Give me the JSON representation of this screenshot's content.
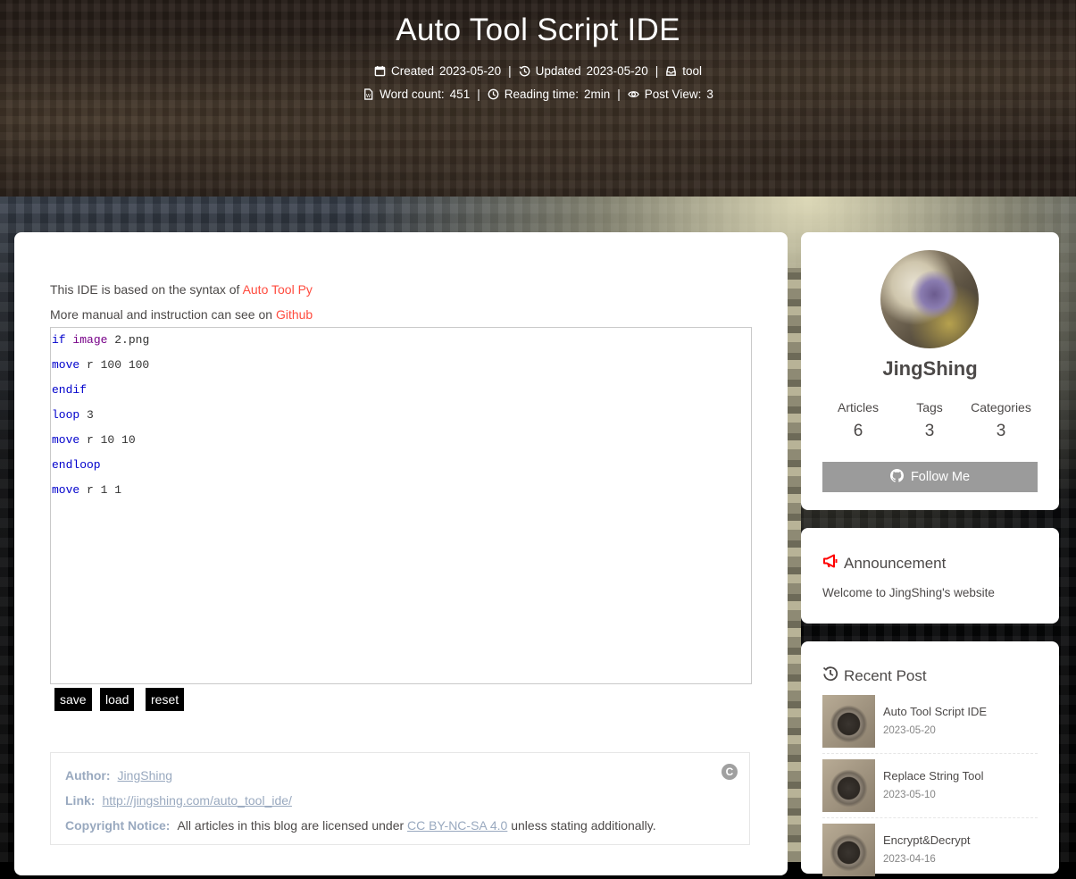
{
  "header": {
    "title": "Auto Tool Script IDE",
    "created_label": "Created",
    "created_date": "2023-05-20",
    "updated_label": "Updated",
    "updated_date": "2023-05-20",
    "category": "tool",
    "word_count_label": "Word count:",
    "word_count": "451",
    "reading_time_label": "Reading time:",
    "reading_time": "2min",
    "post_view_label": "Post View:",
    "post_view": "3",
    "separator": "|"
  },
  "intro": {
    "line1_prefix": "This IDE is based on the syntax of ",
    "line1_link": "Auto Tool Py",
    "line2_prefix": "More manual and instruction can see on ",
    "line2_link": "Github"
  },
  "editor": {
    "lines": [
      {
        "kw": "if",
        "kw2": "image",
        "rest": " 2.png"
      },
      {
        "kw": "move",
        "kw2": "",
        "rest": " r 100 100"
      },
      {
        "kw": "endif",
        "kw2": "",
        "rest": ""
      },
      {
        "kw": "loop",
        "kw2": "",
        "rest": " 3"
      },
      {
        "kw": "move",
        "kw2": "",
        "rest": " r 10 10"
      },
      {
        "kw": "endloop",
        "kw2": "",
        "rest": ""
      },
      {
        "kw": "move",
        "kw2": "",
        "rest": " r 1 1"
      }
    ]
  },
  "buttons": {
    "save": "save",
    "load": "load",
    "reset": "reset"
  },
  "copyright": {
    "author_key": "Author:",
    "author_val": "JingShing",
    "link_key": "Link:",
    "link_val": "http://jingshing.com/auto_tool_ide/",
    "notice_key": "Copyright Notice:",
    "notice_prefix": "All articles in this blog are licensed under ",
    "notice_link": "CC BY-NC-SA 4.0",
    "notice_suffix": " unless stating additionally.",
    "cc_badge": "C"
  },
  "author": {
    "name": "JingShing",
    "articles_label": "Articles",
    "articles": "6",
    "tags_label": "Tags",
    "tags": "3",
    "categories_label": "Categories",
    "categories": "3",
    "follow_label": "Follow Me"
  },
  "announcement": {
    "title": "Announcement",
    "text": "Welcome to JingShing's website",
    "icon": "megaphone-icon",
    "icon_color": "#ff0000"
  },
  "recent": {
    "title": "Recent Post",
    "posts": [
      {
        "title": "Auto Tool Script IDE",
        "date": "2023-05-20"
      },
      {
        "title": "Replace String Tool",
        "date": "2023-05-10"
      },
      {
        "title": "Encrypt&Decrypt",
        "date": "2023-04-16"
      }
    ]
  },
  "colors": {
    "link_accent": "#ff4b3e",
    "keyword": "#0000cc",
    "keyword_alt": "#770088",
    "copyright_key": "#99a9bf",
    "follow_button": "#9b9b9b"
  }
}
